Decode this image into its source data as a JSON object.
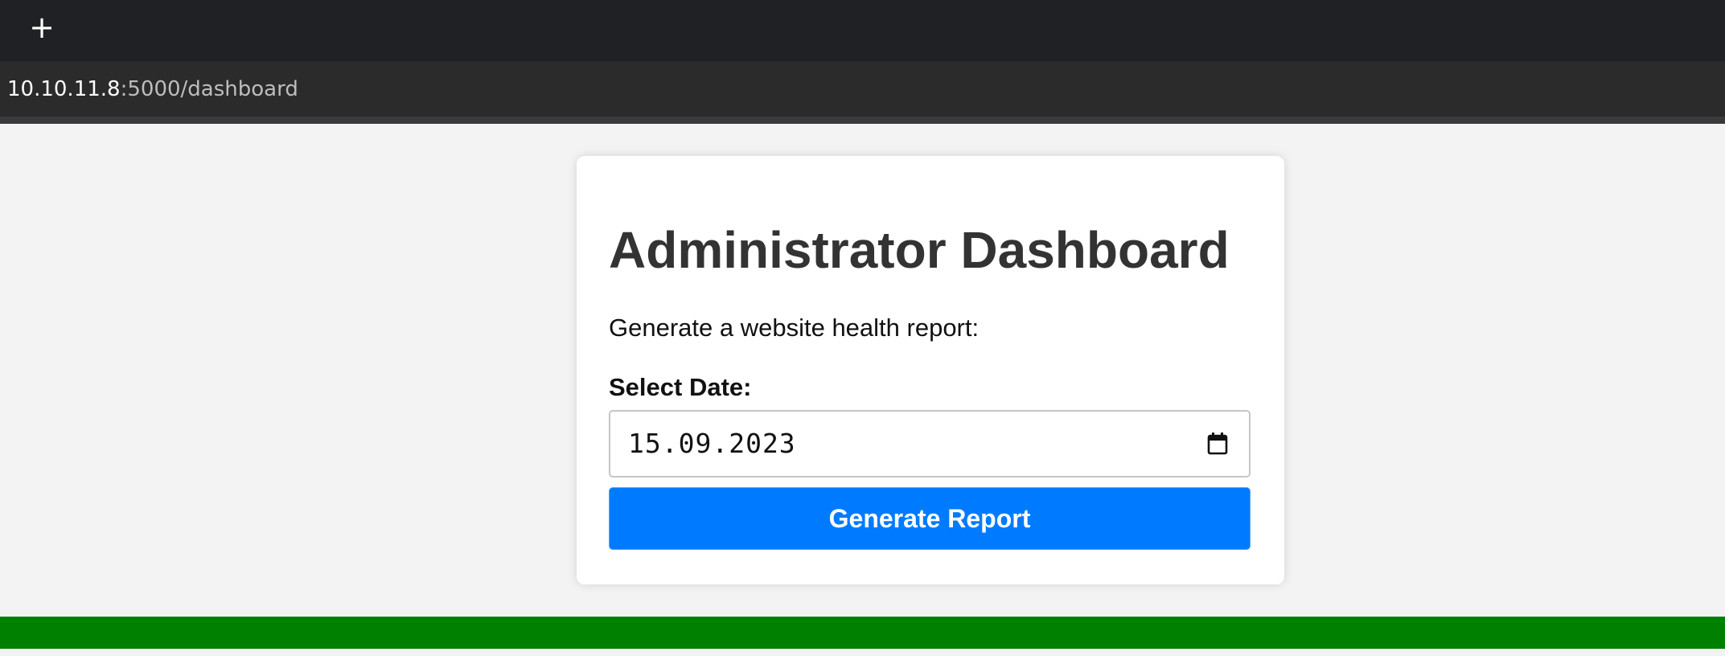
{
  "browser": {
    "new_tab_symbol": "+",
    "url_host": "10.10.11.8",
    "url_rest": ":5000/dashboard"
  },
  "icons": {
    "new_tab": "plus-icon",
    "calendar": "calendar-icon"
  },
  "card": {
    "title": "Administrator Dashboard",
    "description": "Generate a website health report:",
    "date_label": "Select Date:",
    "date_value": "15.09.2023",
    "button_label": "Generate Report"
  },
  "colors": {
    "button_bg": "#007bff",
    "footer_bar": "#008000",
    "title_text": "#333333",
    "page_bg": "#f3f3f3"
  }
}
